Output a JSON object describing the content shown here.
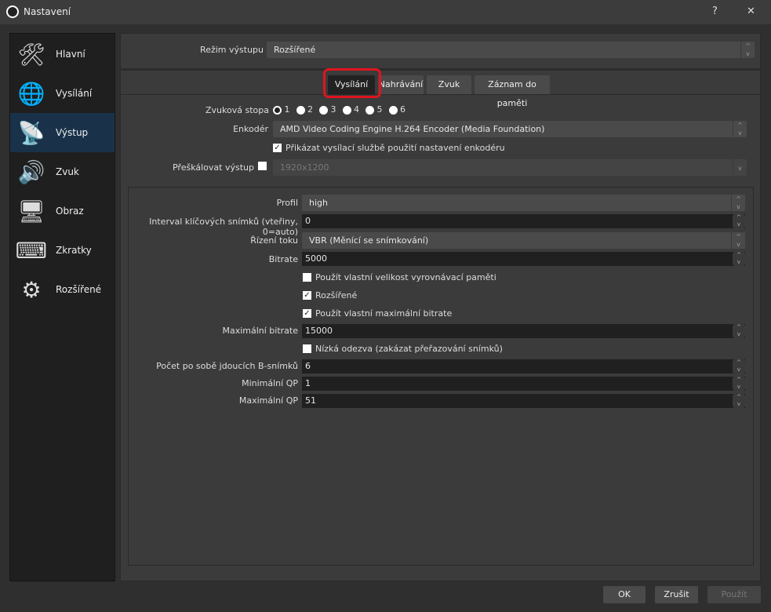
{
  "window": {
    "title": "Nastavení",
    "help": "?",
    "close": "✕"
  },
  "sidebar": {
    "items": [
      {
        "label": "Hlavní",
        "icon": "🛠"
      },
      {
        "label": "Vysílání",
        "icon": "🌐"
      },
      {
        "label": "Výstup",
        "icon": "📡"
      },
      {
        "label": "Zvuk",
        "icon": "🔊"
      },
      {
        "label": "Obraz",
        "icon": "🖥"
      },
      {
        "label": "Zkratky",
        "icon": "⌨"
      },
      {
        "label": "Rozšířené",
        "icon": "⚙"
      }
    ]
  },
  "output_mode": {
    "label": "Režim výstupu",
    "value": "Rozšířené"
  },
  "tabs": [
    "Vysílání",
    "Nahrávání",
    "Zvuk",
    "Záznam do paměti"
  ],
  "stream": {
    "audio_track": {
      "label": "Zvuková stopa",
      "options": [
        "1",
        "2",
        "3",
        "4",
        "5",
        "6"
      ],
      "selected": "1"
    },
    "encoder": {
      "label": "Enkodér",
      "value": "AMD Video Coding Engine H.264 Encoder (Media Foundation)"
    },
    "enforce": {
      "label": "Přikázat vysílací službě použití nastavení enkodéru",
      "checked": true
    },
    "rescale": {
      "label": "Přeškálovat výstup",
      "value": "1920x1200",
      "checked": false
    }
  },
  "encoder_settings": {
    "profile": {
      "label": "Profil",
      "value": "high"
    },
    "keyframe": {
      "label": "Interval klíčových snímků (vteřiny, 0=auto)",
      "value": "0"
    },
    "rate_control": {
      "label": "Řízení toku",
      "value": "VBR (Měnící se snímkování)"
    },
    "bitrate": {
      "label": "Bitrate",
      "value": "5000"
    },
    "custom_buffer": {
      "label": "Použít vlastní velikost vyrovnávací paměti",
      "checked": false
    },
    "advanced": {
      "label": "Rozšířené",
      "checked": true
    },
    "custom_max": {
      "label": "Použít vlastní maximální bitrate",
      "checked": true
    },
    "max_bitrate": {
      "label": "Maximální bitrate",
      "value": "15000"
    },
    "low_latency": {
      "label": "Nízká odezva (zakázat přeřazování snímků)",
      "checked": false
    },
    "bframes": {
      "label": "Počet po sobě jdoucích B-snímků",
      "value": "6"
    },
    "min_qp": {
      "label": "Minimální QP",
      "value": "1"
    },
    "max_qp": {
      "label": "Maximální QP",
      "value": "51"
    }
  },
  "buttons": {
    "ok": "OK",
    "cancel": "Zrušit",
    "apply": "Použít"
  },
  "colors": {
    "highlight": "#e0141e",
    "active_sidebar": "#19324a"
  }
}
